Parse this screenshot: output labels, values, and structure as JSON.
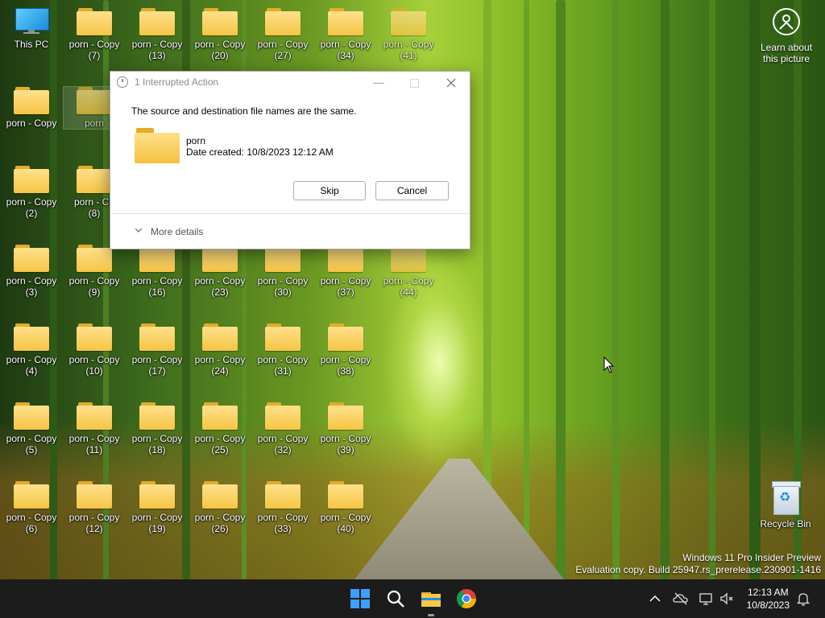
{
  "desktop": {
    "this_pc": "This PC",
    "recycle_bin": "Recycle Bin",
    "learn_line1": "Learn about",
    "learn_line2": "this picture",
    "folder_name_main": "porn",
    "icons": [
      {
        "l1": "porn - Copy",
        "l2": "(7)"
      },
      {
        "l1": "porn - Copy",
        "l2": "(13)"
      },
      {
        "l1": "porn - Copy",
        "l2": "(20)"
      },
      {
        "l1": "porn - Copy",
        "l2": "(27)"
      },
      {
        "l1": "porn - Copy",
        "l2": "(34)"
      },
      {
        "l1": "porn - Copy",
        "l2": "(41)"
      },
      {
        "l1": "porn - Copy",
        "l2": ""
      },
      {
        "l1": "porn",
        "l2": ""
      },
      {
        "l1": "porn - Copy",
        "l2": "(2)"
      },
      {
        "l1": "porn - Co",
        "l2": "(8)"
      },
      {
        "l1": "porn - Copy",
        "l2": "(3)"
      },
      {
        "l1": "porn - Copy",
        "l2": "(9)"
      },
      {
        "l1": "porn - Copy",
        "l2": "(16)"
      },
      {
        "l1": "porn - Copy",
        "l2": "(23)"
      },
      {
        "l1": "porn - Copy",
        "l2": "(30)"
      },
      {
        "l1": "porn - Copy",
        "l2": "(37)"
      },
      {
        "l1": "porn - Copy",
        "l2": "(44)"
      },
      {
        "l1": "porn - Copy",
        "l2": "(4)"
      },
      {
        "l1": "porn - Copy",
        "l2": "(10)"
      },
      {
        "l1": "porn - Copy",
        "l2": "(17)"
      },
      {
        "l1": "porn - Copy",
        "l2": "(24)"
      },
      {
        "l1": "porn - Copy",
        "l2": "(31)"
      },
      {
        "l1": "porn - Copy",
        "l2": "(38)"
      },
      {
        "l1": "porn - Copy",
        "l2": "(5)"
      },
      {
        "l1": "porn - Copy",
        "l2": "(11)"
      },
      {
        "l1": "porn - Copy",
        "l2": "(18)"
      },
      {
        "l1": "porn - Copy",
        "l2": "(25)"
      },
      {
        "l1": "porn - Copy",
        "l2": "(32)"
      },
      {
        "l1": "porn - Copy",
        "l2": "(39)"
      },
      {
        "l1": "porn - Copy",
        "l2": "(6)"
      },
      {
        "l1": "porn - Copy",
        "l2": "(12)"
      },
      {
        "l1": "porn - Copy",
        "l2": "(19)"
      },
      {
        "l1": "porn - Copy",
        "l2": "(26)"
      },
      {
        "l1": "porn - Copy",
        "l2": "(33)"
      },
      {
        "l1": "porn - Copy",
        "l2": "(40)"
      }
    ]
  },
  "dialog": {
    "title": "1 Interrupted Action",
    "message": "The source and destination file names are the same.",
    "file_name": "porn",
    "date_created": "Date created: 10/8/2023 12:12 AM",
    "skip_label": "Skip",
    "cancel_label": "Cancel",
    "more_details": "More details"
  },
  "watermark": {
    "line1": "Windows 11 Pro Insider Preview",
    "line2": "Evaluation copy. Build 25947.rs_prerelease.230901-1416"
  },
  "taskbar": {
    "icons": [
      "start-icon",
      "search-icon",
      "file-explorer-icon",
      "chrome-icon"
    ],
    "tray_icons": [
      "chevron-up-icon",
      "onedrive-offline-icon",
      "network-icon",
      "volume-muted-icon",
      "notification-bell-icon"
    ],
    "time": "12:13 AM",
    "date": "10/8/2023"
  },
  "colors": {
    "taskbar_bg": "#1c1c1c",
    "folder_yellow": "#f5c545",
    "start_blue": "#1e90ff"
  }
}
